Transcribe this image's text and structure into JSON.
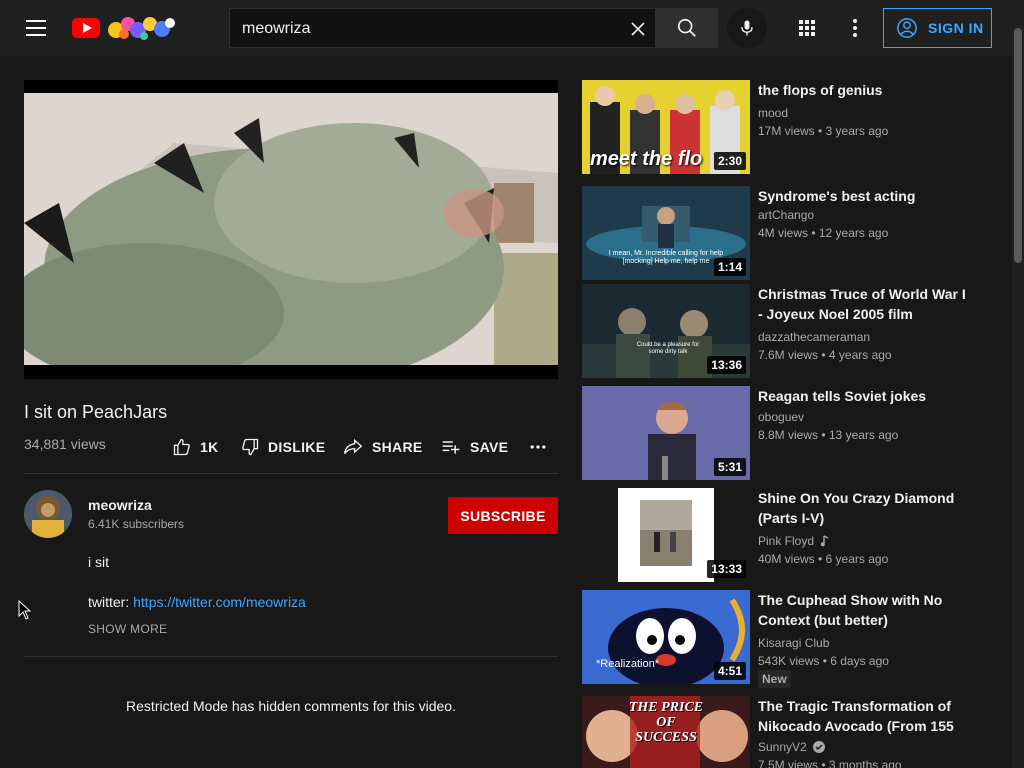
{
  "search": {
    "query": "meowriza"
  },
  "header": {
    "sign_in_label": "SIGN IN"
  },
  "video": {
    "title": "I sit on PeachJars",
    "views": "34,881 views",
    "likes": "1K",
    "dislike_label": "DISLIKE",
    "share_label": "SHARE",
    "save_label": "SAVE"
  },
  "channel": {
    "name": "meowriza",
    "subscribers": "6.41K subscribers",
    "subscribe_label": "SUBSCRIBE"
  },
  "description": {
    "line1": "i sit",
    "twitter_label": "twitter: ",
    "twitter_link": "https://twitter.com/meowriza",
    "show_more": "SHOW MORE"
  },
  "comments": {
    "restricted_text": "Restricted Mode has hidden comments for this video."
  },
  "recommendations": [
    {
      "title": "the flops of genius",
      "channel": "mood",
      "meta": "17M views • 3 years ago",
      "duration": "2:30",
      "thumb_text": "meet the flo"
    },
    {
      "title": "Syndrome's best acting",
      "channel": "artChango",
      "meta": "4M views • 12 years ago",
      "duration": "1:14",
      "thumb_text": "I mean, Mr. Incredible calling for help [mocking] Help me, help me"
    },
    {
      "title": "Christmas Truce of World War I - Joyeux Noel 2005 film",
      "channel": "dazzathecameraman",
      "meta": "7.6M views • 4 years ago",
      "duration": "13:36",
      "thumb_text": "Could be a pleasure for some dirty talk"
    },
    {
      "title": "Reagan tells Soviet jokes",
      "channel": "oboguev",
      "meta": "8.8M views • 13 years ago",
      "duration": "5:31"
    },
    {
      "title": "Shine On You Crazy Diamond (Parts I-V)",
      "channel": "Pink Floyd",
      "meta": "40M views • 6 years ago",
      "duration": "13:33",
      "music_icon": "music-note-icon"
    },
    {
      "title": "The Cuphead Show with No Context (but better)",
      "channel": "Kisaragi Club",
      "meta": "543K views • 6 days ago",
      "duration": "4:51",
      "badge": "New",
      "thumb_text": "*Realization*"
    },
    {
      "title": "The Tragic Transformation of Nikocado Avocado (From 155 ...",
      "channel": "SunnyV2",
      "meta": "7.5M views • 3 months ago",
      "verified_icon": "verified-check-icon",
      "thumb_text": "THE PRICE OF SUCCESS"
    }
  ]
}
